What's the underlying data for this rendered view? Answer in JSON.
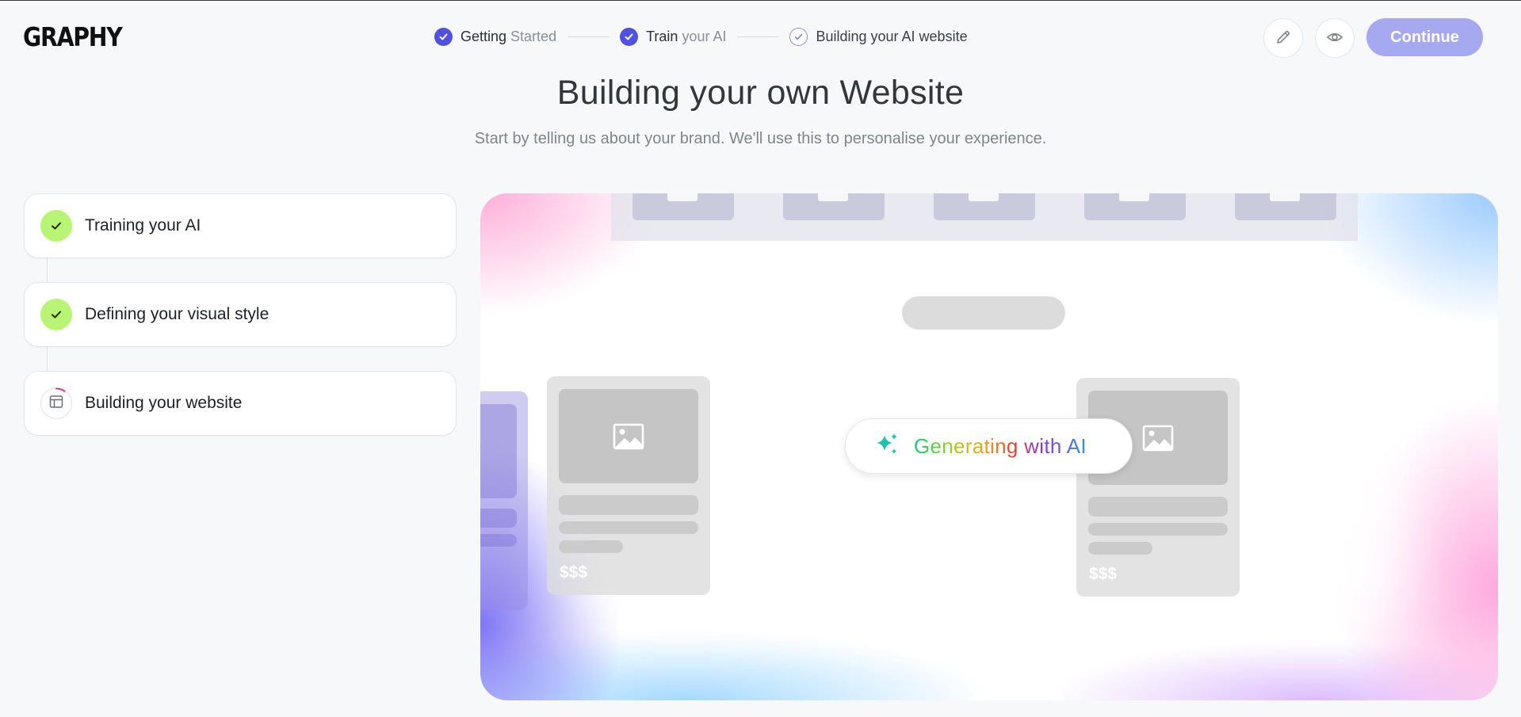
{
  "header": {
    "logo": "GRAPHY",
    "steps": [
      {
        "label_main": "Getting",
        "label_muted": " Started",
        "state": "done"
      },
      {
        "label_main": "Train",
        "label_muted": " your AI",
        "state": "done"
      },
      {
        "label_main": "Building your AI website",
        "label_muted": "",
        "state": "current"
      }
    ],
    "edit_icon": "pencil-icon",
    "preview_icon": "eye-icon",
    "continue_label": "Continue"
  },
  "main": {
    "title": "Building your own Website",
    "subtitle": "Start by telling us about your brand. We'll use this to personalise your experience."
  },
  "progress": {
    "items": [
      {
        "label": "Training your AI",
        "state": "done"
      },
      {
        "label": "Defining your visual style",
        "state": "done"
      },
      {
        "label": "Building your website",
        "state": "in-progress"
      }
    ]
  },
  "preview": {
    "generating_label": "Generating with AI",
    "price_placeholder": "$$$"
  },
  "colors": {
    "accent": "#4f52e0",
    "continue_bg": "#a6a9f0",
    "done_green": "#b8f574",
    "page_bg": "#f7f8fa"
  }
}
